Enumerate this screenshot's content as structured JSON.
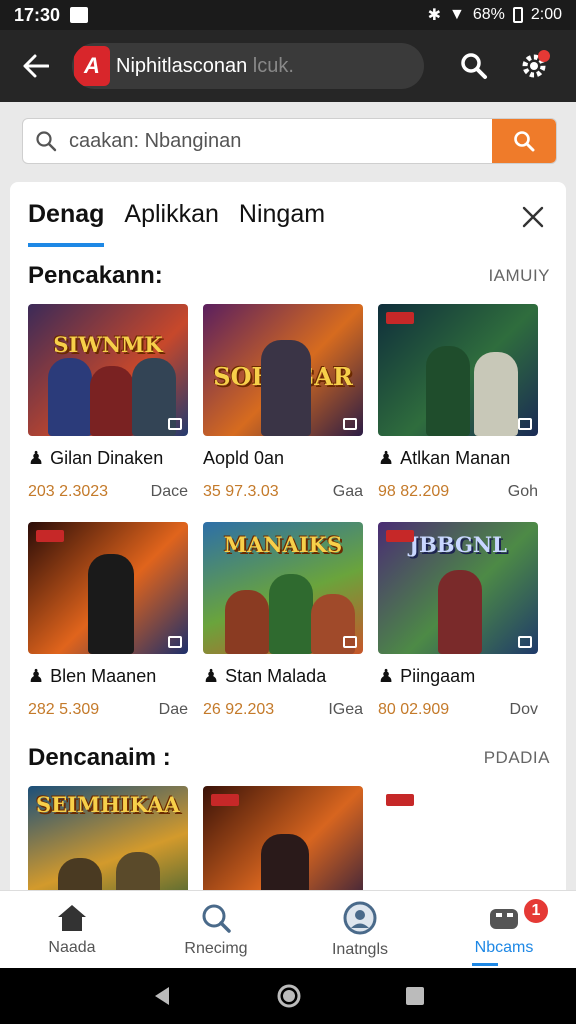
{
  "status": {
    "time": "17:30",
    "battery": "68%",
    "clock_right": "2:00"
  },
  "app_bar": {
    "logo_letter": "A",
    "title": "Niphitlasconan",
    "title_suffix": "lcuk."
  },
  "search": {
    "placeholder": "caakan: Nbanginan"
  },
  "tabs": [
    {
      "label": "Denag",
      "active": true
    },
    {
      "label": "Aplikkan",
      "active": false
    },
    {
      "label": "Ningam",
      "active": false
    }
  ],
  "section1": {
    "title": "Pencakann:",
    "link": "IAMUIY",
    "games": [
      {
        "thumb_title": "SIWNMK",
        "name": "Gilan Dinaken",
        "num": "203 2.3023",
        "tag": "Dace",
        "colors": [
          "#3b2a58",
          "#c7482b",
          "#233a6e"
        ]
      },
      {
        "thumb_title": "SOBNGAR",
        "name": "Aopld 0an",
        "num": "35 97.3.03",
        "tag": "Gaa",
        "colors": [
          "#5a1f5e",
          "#d66b1f",
          "#2c1d45"
        ]
      },
      {
        "thumb_title": "",
        "name": "Atlkan Manan",
        "num": "98 82.209",
        "tag": "Goh",
        "colors": [
          "#0f2e3b",
          "#2f6d3d",
          "#1a2a55"
        ]
      }
    ]
  },
  "section1_row2": {
    "games": [
      {
        "thumb_title": "",
        "name": "Blen Maanen",
        "num": "282 5.309",
        "tag": "Dae",
        "colors": [
          "#2a0c08",
          "#e0641c",
          "#1d2f6b"
        ]
      },
      {
        "thumb_title": "MANAIKS",
        "name": "Stan Malada",
        "num": "26 92.203",
        "tag": "IGea",
        "colors": [
          "#2d6fa8",
          "#6aa43c",
          "#c7562a"
        ]
      },
      {
        "thumb_title": "JBBGNL",
        "name": "Piingaam",
        "num": "80 02.909",
        "tag": "Dov",
        "colors": [
          "#4a2c74",
          "#4d8a46",
          "#1f3a6a"
        ]
      }
    ]
  },
  "section2": {
    "title": "Dencanaim :",
    "link": "PDADIA",
    "games": [
      {
        "thumb_title": "SEIMHIKAA",
        "colors": [
          "#1b4f7a",
          "#d39a2c",
          "#2d5a34"
        ]
      },
      {
        "thumb_title": "",
        "colors": [
          "#3a1208",
          "#d7651f",
          "#261a3e"
        ]
      },
      {
        "thumb_title": "",
        "colors": [
          "#ffffff",
          "#ffffff",
          "#ffffff"
        ]
      }
    ]
  },
  "bottom_nav": [
    {
      "label": "Naada",
      "icon": "home-icon"
    },
    {
      "label": "Rnecimg",
      "icon": "search-icon"
    },
    {
      "label": "Inatngls",
      "icon": "user-circle-icon"
    },
    {
      "label": "Nbcams",
      "icon": "gamepad-icon",
      "badge": "1"
    }
  ],
  "colors": {
    "accent": "#1e88e5",
    "search_button": "#ef7b2a",
    "app_bar": "#262626",
    "logo": "#d8262b"
  }
}
